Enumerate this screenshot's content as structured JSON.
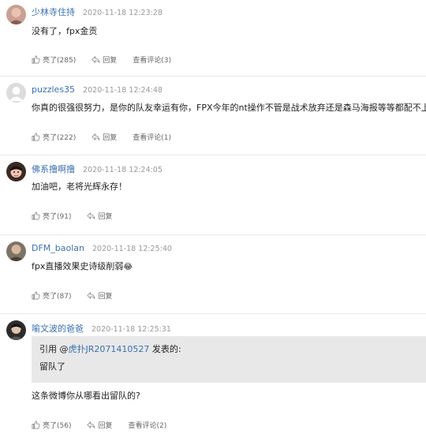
{
  "comments": [
    {
      "author": "少林寺住持",
      "time": "2020-11-18 12:23:28",
      "text": "没有了，fpx金贡",
      "like": "亮了(285)",
      "reply": "回复",
      "view": "查看评论(3)"
    },
    {
      "author": "puzzles35",
      "time": "2020-11-18 12:24:48",
      "text": "你真的很强很努力，是你的队友幸运有你，FPX今年的nt操作不管是战术放弃还是森马海报等等都配不上你",
      "like": "亮了(222)",
      "reply": "回复",
      "view": "查看评论(1)"
    },
    {
      "author": "佛系撸啊撸",
      "time": "2020-11-18 12:24:05",
      "text": "加油吧，老将光辉永存！",
      "like": "亮了(91)",
      "reply": "回复"
    },
    {
      "author": "DFM_baolan",
      "time": "2020-11-18 12:25:40",
      "text": "fpx直播效果史诗级削弱",
      "emoji": "😂",
      "like": "亮了(87)",
      "reply": "回复"
    },
    {
      "author": "喻文波的爸爸",
      "time": "2020-11-18 12:25:31",
      "quote": {
        "prefix": "引用 @",
        "user": "虎扑JR2071410527",
        "suffix": " 发表的:",
        "text": "留队了"
      },
      "text": "这条微博你从哪看出留队的?",
      "like": "亮了(56)",
      "reply": "回复",
      "view": "查看评论(2)"
    }
  ]
}
